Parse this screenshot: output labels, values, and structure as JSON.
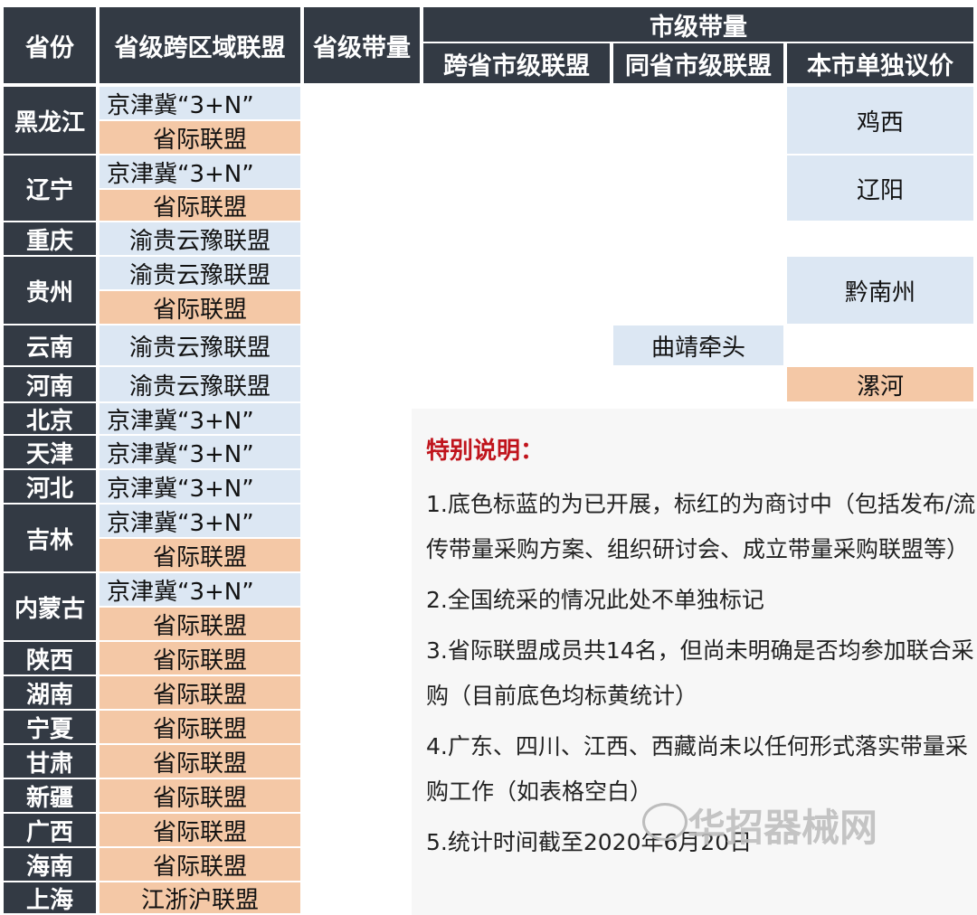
{
  "headers": {
    "province": "省份",
    "cross_region_alliance": "省级跨区域联盟",
    "provincial_volume": "省级带量",
    "city_level": "市级带量",
    "cross_province_city": "跨省市级联盟",
    "same_province_city": "同省市级联盟",
    "city_alone": "本市单独议价"
  },
  "rows": [
    {
      "province": "黑龙江",
      "alliances": [
        "京津冀“3+N”",
        "省际联盟"
      ],
      "city_alone": "鸡西"
    },
    {
      "province": "辽宁",
      "alliances": [
        "京津冀“3+N”",
        "省际联盟"
      ],
      "city_alone": "辽阳"
    },
    {
      "province": "重庆",
      "alliances": [
        "渝贵云豫联盟"
      ]
    },
    {
      "province": "贵州",
      "alliances": [
        "渝贵云豫联盟",
        "省际联盟"
      ],
      "city_alone": "黔南州"
    },
    {
      "province": "云南",
      "alliances": [
        "渝贵云豫联盟"
      ],
      "same_province_city": "曲靖牵头"
    },
    {
      "province": "河南",
      "alliances": [
        "渝贵云豫联盟"
      ],
      "city_alone": "漯河"
    },
    {
      "province": "北京",
      "alliances": [
        "京津冀“3+N”"
      ]
    },
    {
      "province": "天津",
      "alliances": [
        "京津冀“3+N”"
      ]
    },
    {
      "province": "河北",
      "alliances": [
        "京津冀“3+N”"
      ]
    },
    {
      "province": "吉林",
      "alliances": [
        "京津冀“3+N”",
        "省际联盟"
      ]
    },
    {
      "province": "内蒙古",
      "alliances": [
        "京津冀“3+N”",
        "省际联盟"
      ]
    },
    {
      "province": "陕西",
      "alliances": [
        "省际联盟"
      ]
    },
    {
      "province": "湖南",
      "alliances": [
        "省际联盟"
      ]
    },
    {
      "province": "宁夏",
      "alliances": [
        "省际联盟"
      ]
    },
    {
      "province": "甘肃",
      "alliances": [
        "省际联盟"
      ]
    },
    {
      "province": "新疆",
      "alliances": [
        "省际联盟"
      ]
    },
    {
      "province": "广西",
      "alliances": [
        "省际联盟"
      ]
    },
    {
      "province": "海南",
      "alliances": [
        "省际联盟"
      ]
    },
    {
      "province": "上海",
      "alliances": [
        "江浙沪联盟"
      ]
    }
  ],
  "notes": {
    "title": "特别说明：",
    "items": [
      "1.底色标蓝的为已开展，标红的为商讨中（包括发布/流传带量采购方案、组织研讨会、成立带量采购联盟等）",
      "2.全国统采的情况此处不单独标记",
      "3.省际联盟成员共14名，但尚未明确是否均参加联合采购（目前底色均标黄统计）",
      "4.广东、四川、江西、西藏尚未以任何形式落实带量采购工作（如表格空白）",
      "5.统计时间截至2020年6月20日"
    ]
  },
  "watermark": "华招器械网",
  "colors": {
    "header_bg": "#333a44",
    "started_blue": "#dce7f3",
    "discussing_orange": "#f4c8a6",
    "note_title_red": "#c0141c"
  }
}
